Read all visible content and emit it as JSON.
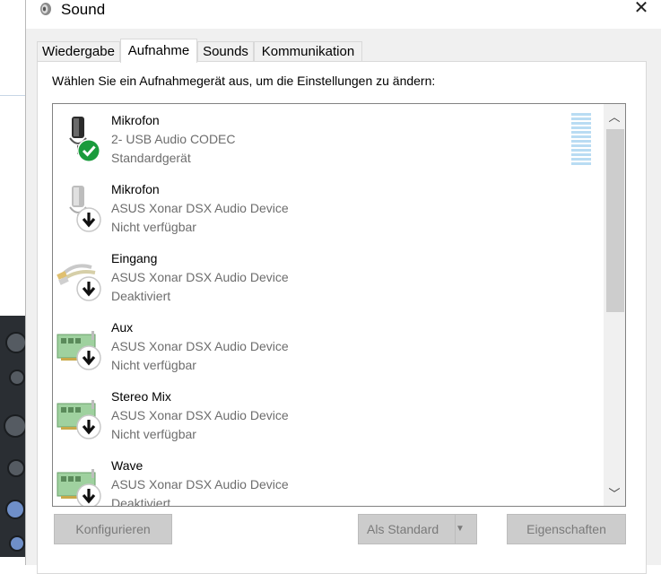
{
  "window": {
    "title": "Sound",
    "close_glyph": "✕"
  },
  "tabs": [
    {
      "label": "Wiedergabe",
      "active": false
    },
    {
      "label": "Aufnahme",
      "active": true
    },
    {
      "label": "Sounds",
      "active": false
    },
    {
      "label": "Kommunikation",
      "active": false
    }
  ],
  "panel": {
    "instruction": "Wählen Sie ein Aufnahmegerät aus, um die Einstellungen zu ändern:"
  },
  "devices": [
    {
      "name": "Mikrofon",
      "description": "2- USB Audio CODEC",
      "status": "Standardgerät",
      "icon": "microphone-icon",
      "badge": "check-icon"
    },
    {
      "name": "Mikrofon",
      "description": "ASUS Xonar DSX Audio Device",
      "status": "Nicht verfügbar",
      "icon": "microphone-icon",
      "badge": "down-arrow-icon"
    },
    {
      "name": "Eingang",
      "description": "ASUS Xonar DSX Audio Device",
      "status": "Deaktiviert",
      "icon": "line-in-cable-icon",
      "badge": "down-arrow-icon"
    },
    {
      "name": "Aux",
      "description": "ASUS Xonar DSX Audio Device",
      "status": "Nicht verfügbar",
      "icon": "sound-card-icon",
      "badge": "down-arrow-icon"
    },
    {
      "name": "Stereo Mix",
      "description": "ASUS Xonar DSX Audio Device",
      "status": "Nicht verfügbar",
      "icon": "sound-card-icon",
      "badge": "down-arrow-icon"
    },
    {
      "name": "Wave",
      "description": "ASUS Xonar DSX Audio Device",
      "status": "Deaktiviert",
      "icon": "sound-card-icon",
      "badge": "down-arrow-icon"
    }
  ],
  "scroll": {
    "up_glyph": "︿",
    "down_glyph": "﹀"
  },
  "buttons": {
    "configure": "Konfigurieren",
    "set_default": "Als Standard",
    "split_arrow": "▼",
    "properties": "Eigenschaften"
  },
  "colors": {
    "accent_check": "#1a9b3c",
    "disabled_button": "#cccccc",
    "level_meter": "#b9dcf3"
  }
}
